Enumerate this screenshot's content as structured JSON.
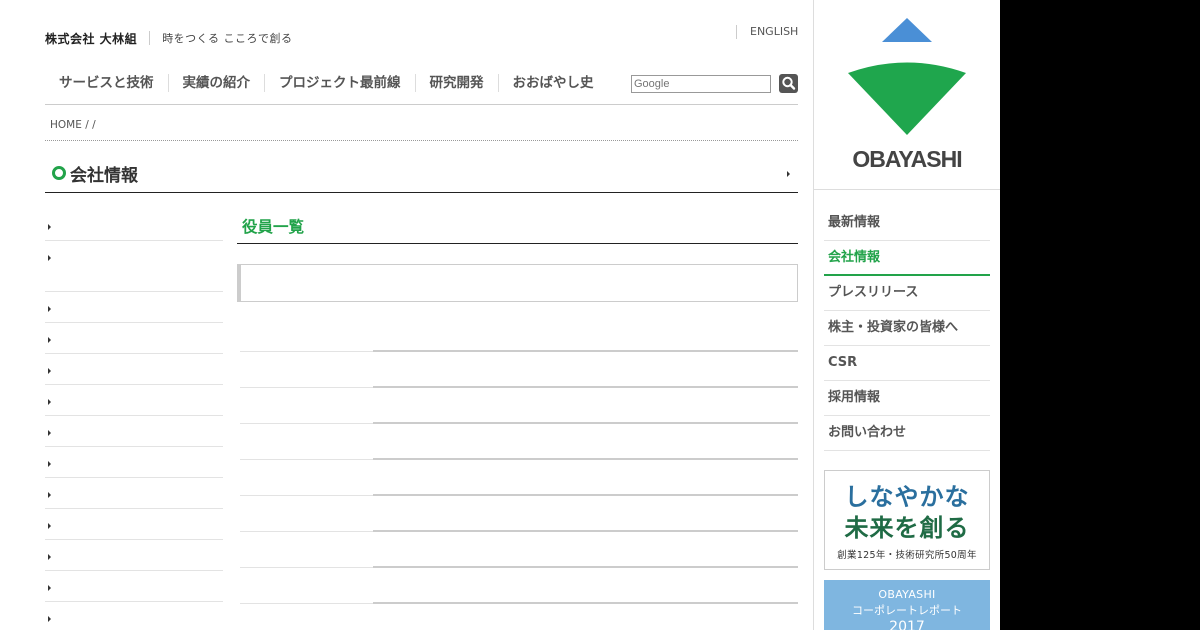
{
  "header": {
    "company_name": "株式会社 大林組",
    "tagline": "時をつくる こころで創る",
    "english_link": "ENGLISH"
  },
  "global_nav": [
    {
      "label": "サービスと技術"
    },
    {
      "label": "実績の紹介"
    },
    {
      "label": "プロジェクト最前線"
    },
    {
      "label": "研究開発"
    },
    {
      "label": "おおばやし史"
    }
  ],
  "search": {
    "placeholder": "Google",
    "button_icon": "search-icon"
  },
  "breadcrumb": {
    "text": "HOME /  /"
  },
  "section": {
    "title": "会社情報"
  },
  "main": {
    "title": "役員一覧"
  },
  "sidebar": {
    "logo_text": "OBAYASHI",
    "nav": [
      {
        "label": "最新情報",
        "active": false
      },
      {
        "label": "会社情報",
        "active": true
      },
      {
        "label": "プレスリリース",
        "active": false
      },
      {
        "label": "株主・投資家の皆様へ",
        "active": false
      },
      {
        "label": "CSR",
        "active": false
      },
      {
        "label": "採用情報",
        "active": false
      },
      {
        "label": "お問い合わせ",
        "active": false
      }
    ],
    "banner_future": {
      "line1": "しなやかな",
      "line2": "未来を創る",
      "subtitle": "創業125年・技術研究所50周年"
    },
    "banner_report": {
      "line1": "OBAYASHI",
      "line2": "コーポレートレポート",
      "line3": "2017"
    }
  },
  "colors": {
    "accent_green": "#22a34a",
    "logo_blue": "#4a8fd6",
    "logo_green": "#1fa64d",
    "banner_blue": "#7fb6e0"
  }
}
